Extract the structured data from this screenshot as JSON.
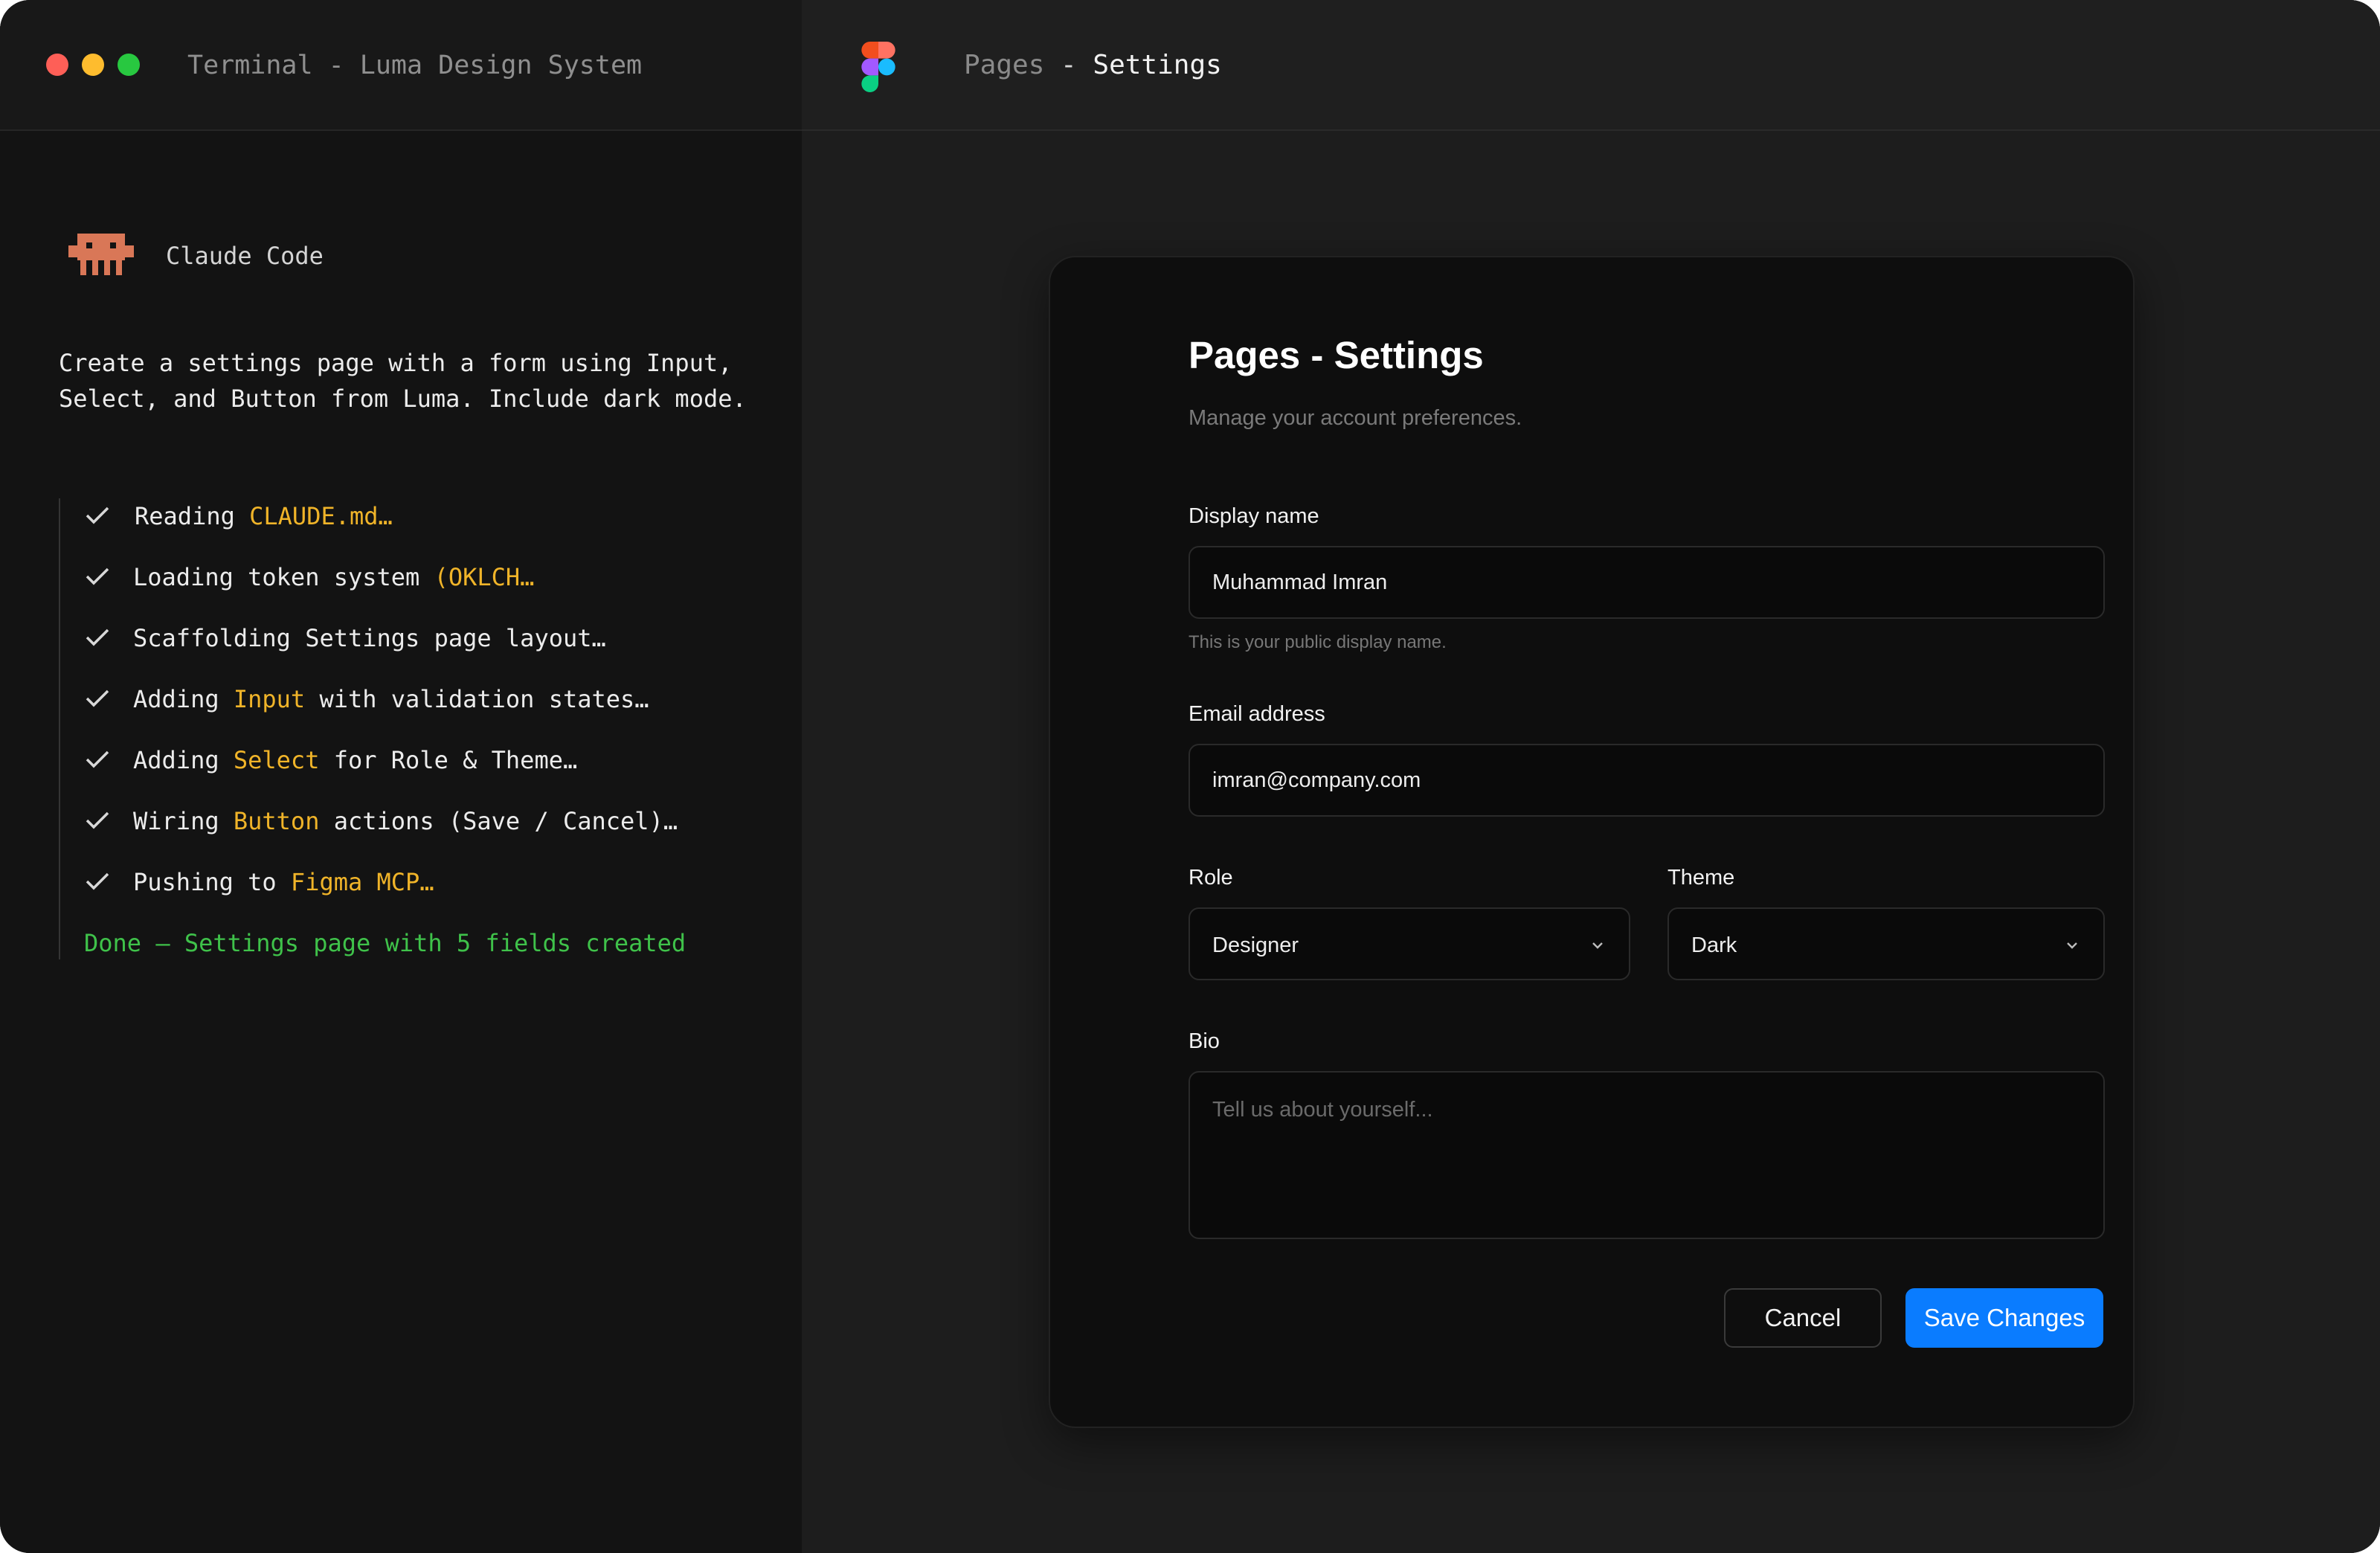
{
  "terminal": {
    "title": "Terminal - Luma Design System",
    "assistant_name": "Claude Code",
    "prompt": "Create a settings page with a form using Input, Select, and Button from Luma. Include dark mode.",
    "tasks": [
      {
        "pre": "Reading ",
        "hl": "CLAUDE.md…",
        "post": ""
      },
      {
        "pre": "Loading token system ",
        "hl": "(OKLCH…",
        "post": ""
      },
      {
        "pre": "Scaffolding Settings page layout…",
        "hl": "",
        "post": ""
      },
      {
        "pre": "Adding ",
        "hl": "Input",
        "post": " with validation states…"
      },
      {
        "pre": "Adding ",
        "hl": "Select",
        "post": " for Role & Theme…"
      },
      {
        "pre": "Wiring ",
        "hl": "Button",
        "post": " actions (Save / Cancel)…"
      },
      {
        "pre": "Pushing to ",
        "hl": "Figma MCP…",
        "post": ""
      }
    ],
    "done_message": "Done — Settings page with 5 fields created"
  },
  "figma": {
    "breadcrumb_parent": "Pages",
    "breadcrumb_sep": " - ",
    "breadcrumb_current": "Settings"
  },
  "settings": {
    "title": "Pages - Settings",
    "subtitle": "Manage your account preferences.",
    "display_name": {
      "label": "Display name",
      "value": "Muhammad Imran",
      "hint": "This is your public display name."
    },
    "email": {
      "label": "Email address",
      "value": "imran@company.com"
    },
    "role": {
      "label": "Role",
      "value": "Designer"
    },
    "theme": {
      "label": "Theme",
      "value": "Dark"
    },
    "bio": {
      "label": "Bio",
      "placeholder": "Tell us about yourself..."
    },
    "cancel_label": "Cancel",
    "save_label": "Save Changes"
  },
  "colors": {
    "accent": "#0a7cff",
    "highlight": "#f0b429",
    "success": "#3fc24a",
    "claude_logo": "#d97757"
  }
}
